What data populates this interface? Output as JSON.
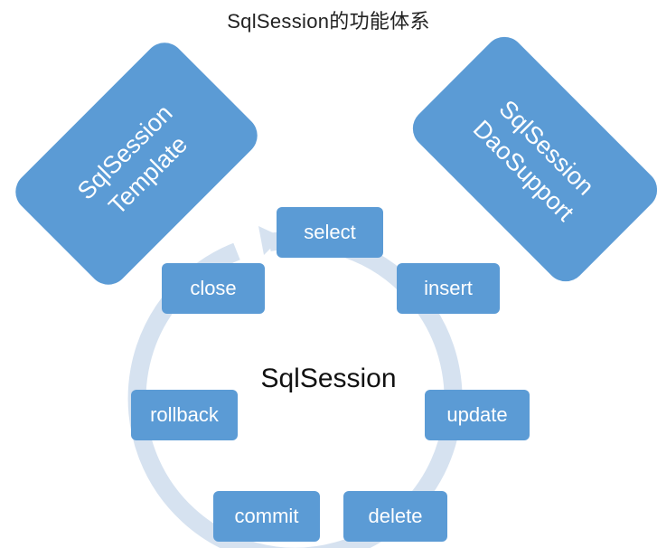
{
  "title": "SqlSession的功能体系",
  "center": "SqlSession",
  "left_box": {
    "line1": "SqlSession",
    "line2": "Template"
  },
  "right_box": {
    "line1": "SqlSession",
    "line2": "DaoSupport"
  },
  "cycle": {
    "select": "select",
    "insert": "insert",
    "update": "update",
    "delete": "delete",
    "commit": "commit",
    "rollback": "rollback",
    "close": "close"
  },
  "colors": {
    "box": "#5b9bd5",
    "ring": "#d6e2f0"
  }
}
